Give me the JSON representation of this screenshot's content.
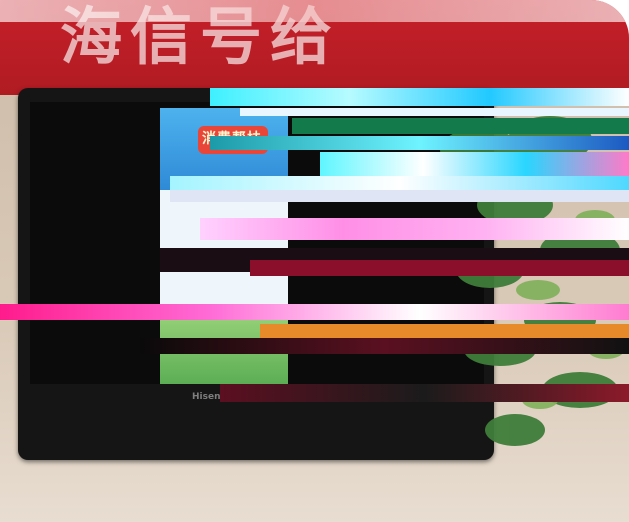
{
  "scene": {
    "banner_text": "海信号给",
    "poster_title": "消费帮扶",
    "tv_brand": "Hisense"
  },
  "colors": {
    "banner_red": "#c7202a",
    "wall": "#d9c9b7",
    "tv_frame": "#151515",
    "leaf_green": "#3f7d3a"
  }
}
